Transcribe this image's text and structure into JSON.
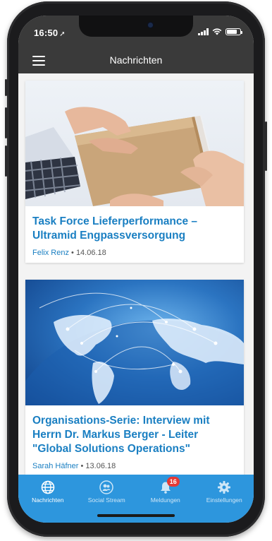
{
  "status_bar": {
    "time": "16:50",
    "location_icon": "location-arrow-icon",
    "icons": [
      "signal-icon",
      "wifi-icon",
      "battery-icon"
    ]
  },
  "header": {
    "menu_icon": "hamburger-menu-icon",
    "title": "Nachrichten"
  },
  "articles": [
    {
      "title": "Task Force Lieferperformance – Ultramid Engpassversorgung",
      "author": "Felix Renz",
      "separator": " • ",
      "date": "14.06.18",
      "image": "hands-passing-cardboard-box"
    },
    {
      "title": "Organisations-Serie: Interview mit Herrn Dr. Markus Berger - Leiter \"Global Solutions Operations\"",
      "author": "Sarah Häfner",
      "separator": " • ",
      "date": "13.06.18",
      "image": "global-network-earth"
    }
  ],
  "tabs": [
    {
      "label": "Nachrichten",
      "icon": "globe-icon",
      "active": true
    },
    {
      "label": "Social Stream",
      "icon": "people-icon",
      "active": false
    },
    {
      "label": "Meldungen",
      "icon": "bell-icon",
      "active": false,
      "badge": "16"
    },
    {
      "label": "Einstellungen",
      "icon": "gear-icon",
      "active": false
    }
  ],
  "colors": {
    "header_bg": "#3a3a3a",
    "accent_blue": "#1a7fc2",
    "tab_bar_bg": "#2d96dd",
    "badge_red": "#e53935"
  }
}
